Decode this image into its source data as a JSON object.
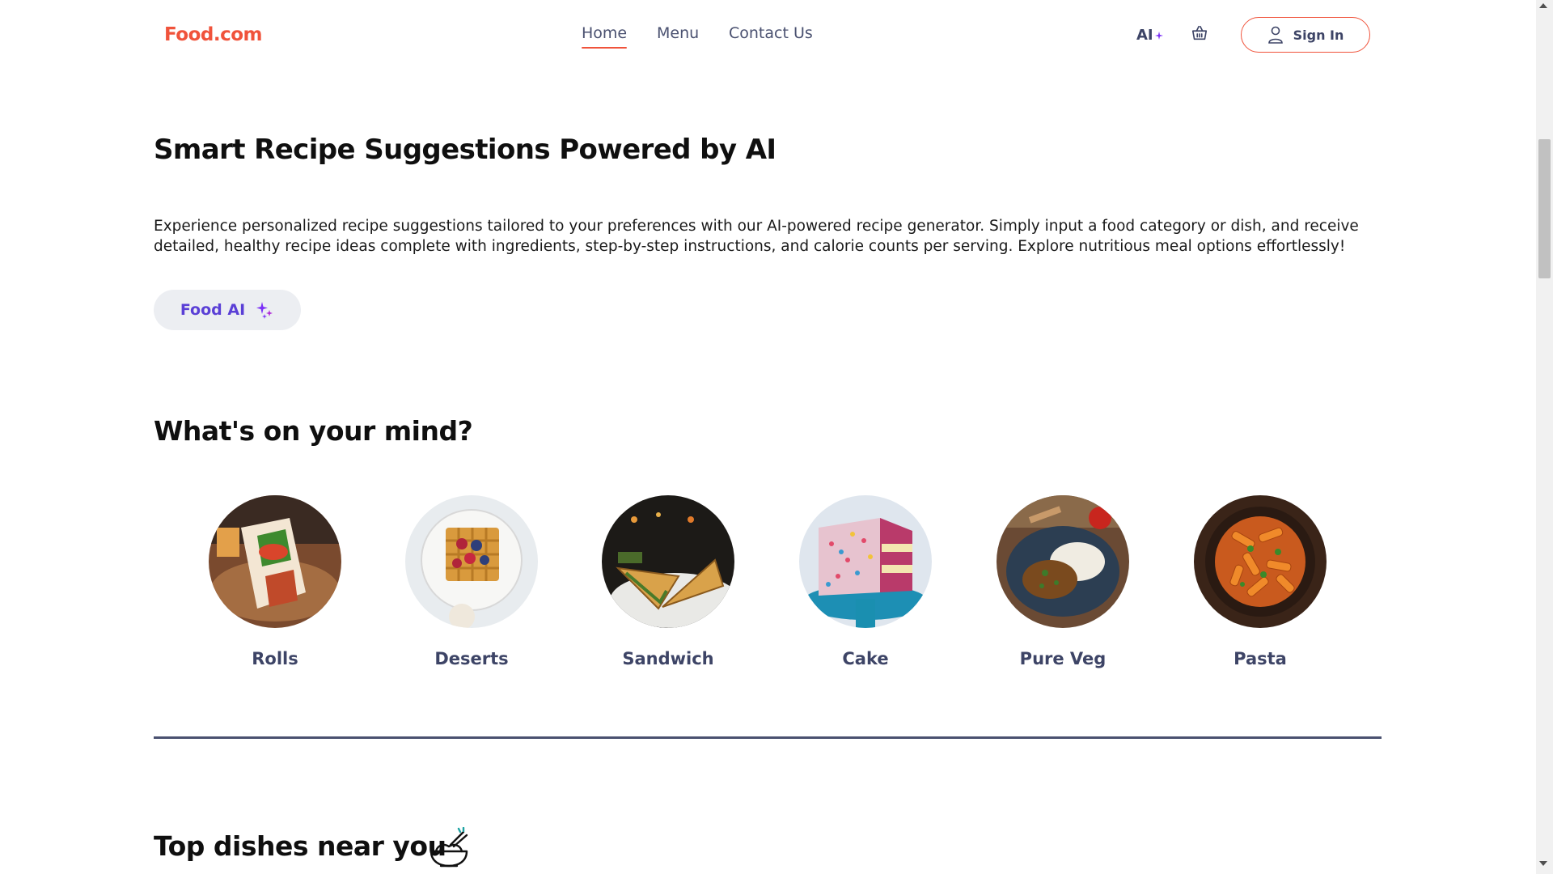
{
  "header": {
    "logo": "Food.com",
    "nav": [
      "Home",
      "Menu",
      "Contact Us"
    ],
    "active_nav": "Home",
    "ai_label": "AI",
    "cart_icon": "basket-icon",
    "signin_label": "Sign In",
    "signin_icon": "user-icon"
  },
  "hero": {
    "title": "Smart Recipe Suggestions Powered by AI",
    "description": "Experience personalized recipe suggestions tailored to your preferences with our AI-powered recipe generator. Simply input a food category or dish, and receive detailed, healthy recipe ideas complete with ingredients, step-by-step instructions, and calorie counts per serving. Explore nutritious meal options effortlessly!",
    "button_label": "Food AI",
    "button_icon": "sparkle-icon"
  },
  "categories": {
    "title": "What's on your mind?",
    "items": [
      {
        "label": "Rolls"
      },
      {
        "label": "Deserts"
      },
      {
        "label": "Sandwich"
      },
      {
        "label": "Cake"
      },
      {
        "label": "Pure Veg"
      },
      {
        "label": "Pasta"
      }
    ]
  },
  "top_dishes": {
    "title": "Top dishes near you",
    "icon": "bowl-icon"
  },
  "colors": {
    "brand": "#f0533b",
    "nav_text": "#4a5170",
    "ai_accent": "#7b2ff7"
  }
}
